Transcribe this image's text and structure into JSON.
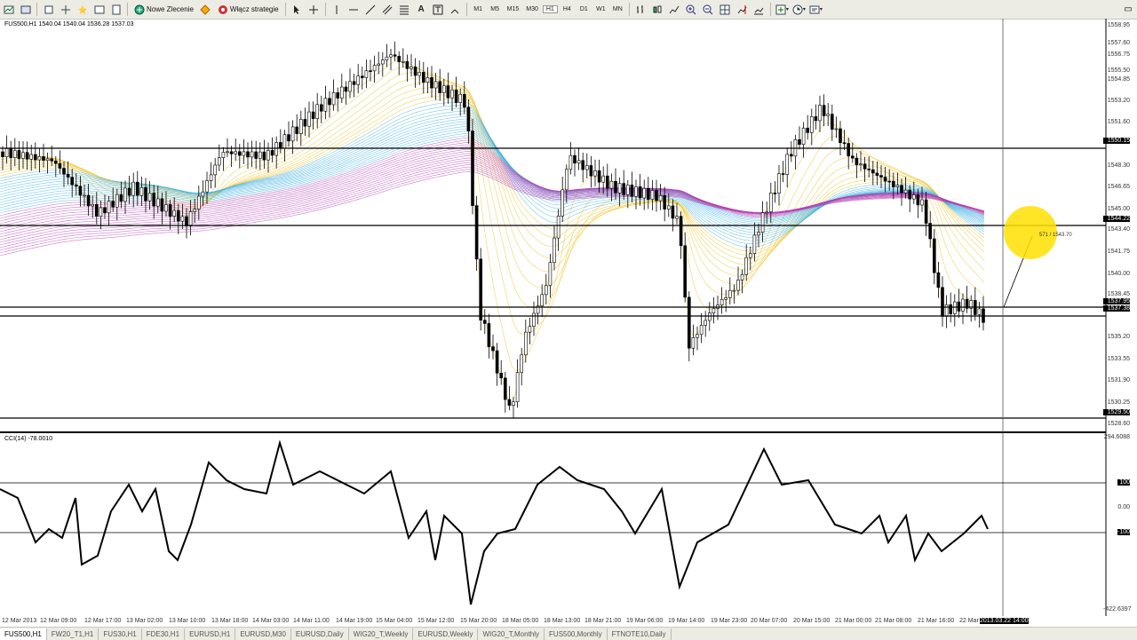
{
  "toolbar": {
    "new_order_label": "Nowe Zlecenie",
    "strategies_label": "Włącz strategie",
    "timeframes": [
      "M1",
      "M5",
      "M15",
      "M30",
      "H1",
      "H4",
      "D1",
      "W1",
      "MN"
    ],
    "active_timeframe": "H1"
  },
  "chart": {
    "symbol_info": "FUS500,H1  1540.04 1540.04 1536.28 1537.03",
    "cci_info": "CCI(14) -78.0010",
    "cursor_readout": "571 / 1543.70",
    "price_axis": [
      "1558.95",
      "1557.60",
      "1556.75",
      "1555.50",
      "1554.85",
      "1553.20",
      "1551.60",
      "1550.15",
      "1548.30",
      "1546.65",
      "1545.00",
      "1544.22",
      "1543.40",
      "1541.75",
      "1540.00",
      "1538.45",
      "1537.95",
      "1537.38",
      "1535.20",
      "1533.55",
      "1531.90",
      "1530.25",
      "1529.50",
      "1528.60"
    ],
    "cci_axis": [
      "294.6088",
      "100",
      "0.00",
      "-100",
      "-422.6397"
    ],
    "time_axis": [
      "12 Mar 2013",
      "12 Mar 09:00",
      "12 Mar 17:00",
      "13 Mar 02:00",
      "13 Mar 10:00",
      "13 Mar 18:00",
      "14 Mar 03:00",
      "14 Mar 11:00",
      "14 Mar 19:00",
      "15 Mar 04:00",
      "15 Mar 12:00",
      "15 Mar 20:00",
      "18 Mar 05:00",
      "18 Mar 13:00",
      "18 Mar 21:00",
      "19 Mar 06:00",
      "19 Mar 14:00",
      "19 Mar 23:00",
      "20 Mar 07:00",
      "20 Mar 15:00",
      "21 Mar 00:00",
      "21 Mar 08:00",
      "21 Mar 16:00",
      "22 Mar",
      "2013.03.22 14:00"
    ]
  },
  "tabs": [
    "FUS500,H1",
    "FW20_T1,H1",
    "FUS30,H1",
    "FDE30,H1",
    "EURUSD,H1",
    "EURUSD,M30",
    "EURUSD,Daily",
    "WIG20_T,Weekly",
    "EURUSD,Weekly",
    "WIG20_T,Monthly",
    "FUS500,Monthly",
    "FTNOTE10,Daily"
  ],
  "active_tab": "FUS500,H1",
  "colors": {
    "background": "#ffffff",
    "candle": "#000000",
    "ribbon_short": "#f0c020",
    "ribbon_mid": "#40b0e0",
    "ribbon_long": "#b040b0",
    "cursor_highlight": "#ffe000"
  }
}
